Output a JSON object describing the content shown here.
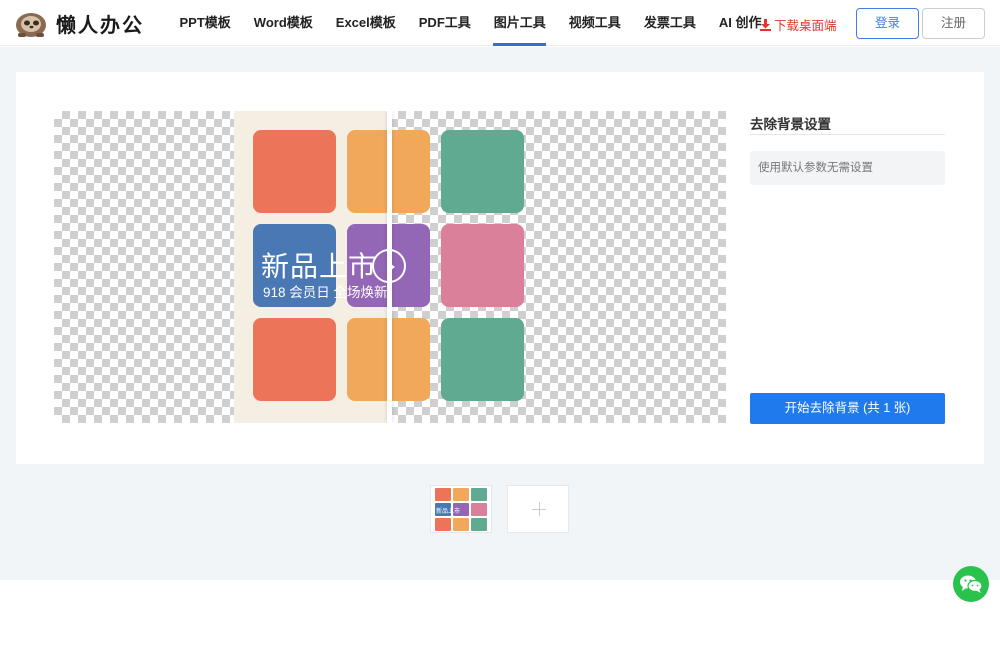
{
  "brand": {
    "name": "懒人办公"
  },
  "nav": {
    "items": [
      "PPT模板",
      "Word模板",
      "Excel模板",
      "PDF工具",
      "图片工具",
      "视频工具",
      "发票工具",
      "AI 创作"
    ],
    "active": "图片工具"
  },
  "header": {
    "download_label": "下载桌面端",
    "login_label": "登录",
    "register_label": "注册"
  },
  "preview": {
    "headline": "新品上市",
    "subline": "918 会员日  全场焕新"
  },
  "settings": {
    "title": "去除背景设置",
    "hint": "使用默认参数无需设置",
    "start_label": "开始去除背景 (共 1 张)"
  },
  "thumbnail": {
    "label": "新品上市"
  },
  "colors": {
    "accent": "#1f7aee",
    "tile_orange": "#ec7459",
    "tile_yellow": "#f2a85a",
    "tile_green": "#5faa90",
    "tile_blue": "#4a78b4",
    "tile_purple": "#9466b6",
    "tile_pink": "#db809a",
    "download_red": "#e2362c",
    "wechat_green": "#28c24d"
  }
}
